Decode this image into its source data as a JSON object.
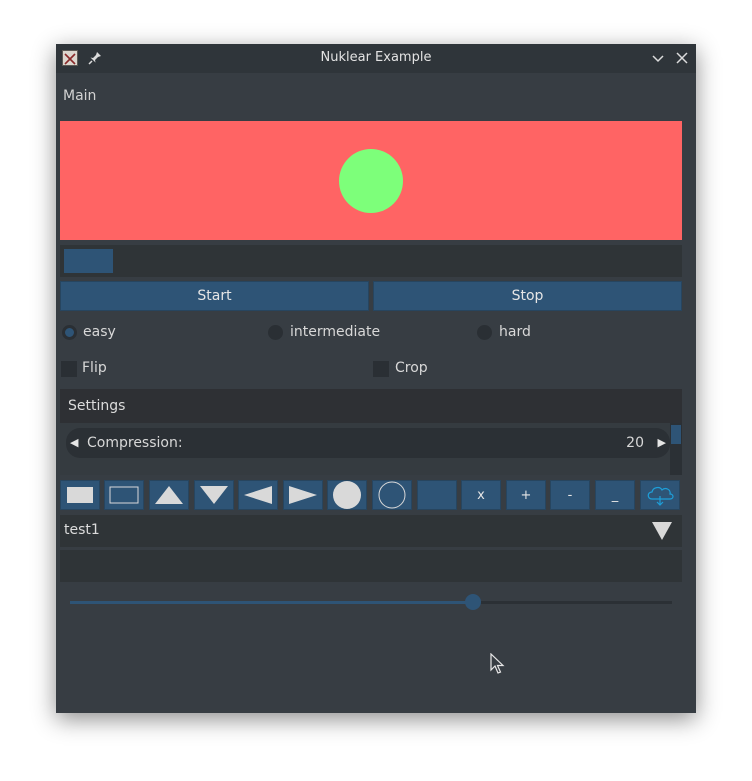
{
  "window": {
    "title": "Nuklear Example"
  },
  "main": {
    "label": "Main"
  },
  "progress": {
    "value": 0.08
  },
  "buttons": {
    "start": "Start",
    "stop": "Stop"
  },
  "difficulty": {
    "options": [
      "easy",
      "intermediate",
      "hard"
    ],
    "selected": "easy"
  },
  "checkboxes": {
    "flip": "Flip",
    "crop": "Crop"
  },
  "settings": {
    "title": "Settings",
    "property": {
      "label": "Compression:",
      "value": "20"
    }
  },
  "toolbar": {
    "icons": [
      "rect-solid-icon",
      "rect-outline-icon",
      "triangle-up-icon",
      "triangle-down-icon",
      "triangle-left-icon",
      "triangle-right-icon",
      "circle-solid-icon",
      "circle-outline-icon",
      "blank-button"
    ],
    "text_buttons": [
      "x",
      "+",
      "-",
      "_"
    ],
    "last_icon": "cloud-icon"
  },
  "combo": {
    "value": "test1"
  },
  "edit": {
    "value": ""
  },
  "slider": {
    "value": 0.67
  },
  "colors": {
    "window_bg": "#373d43",
    "accent": "#2e5476",
    "canvas_bg": "#ff6464",
    "circle": "#7dff7a",
    "cloud": "#1e9fd9"
  }
}
